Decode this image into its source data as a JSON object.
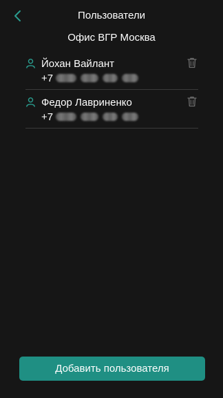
{
  "header": {
    "title": "Пользователи",
    "back_icon": "chevron-left-icon",
    "accent_color": "#2a9d8f"
  },
  "group": {
    "name": "Офис ВГР Москва"
  },
  "users": [
    {
      "name": "Йохан Вайлант",
      "phone_prefix": "+7",
      "phone_hidden": true,
      "user_icon": "user-icon",
      "delete_icon": "trash-icon"
    },
    {
      "name": "Федор Лавриненко",
      "phone_prefix": "+7",
      "phone_hidden": true,
      "user_icon": "user-icon",
      "delete_icon": "trash-icon"
    }
  ],
  "actions": {
    "add_user_label": "Добавить пользователя",
    "button_color": "#1f8f83"
  }
}
